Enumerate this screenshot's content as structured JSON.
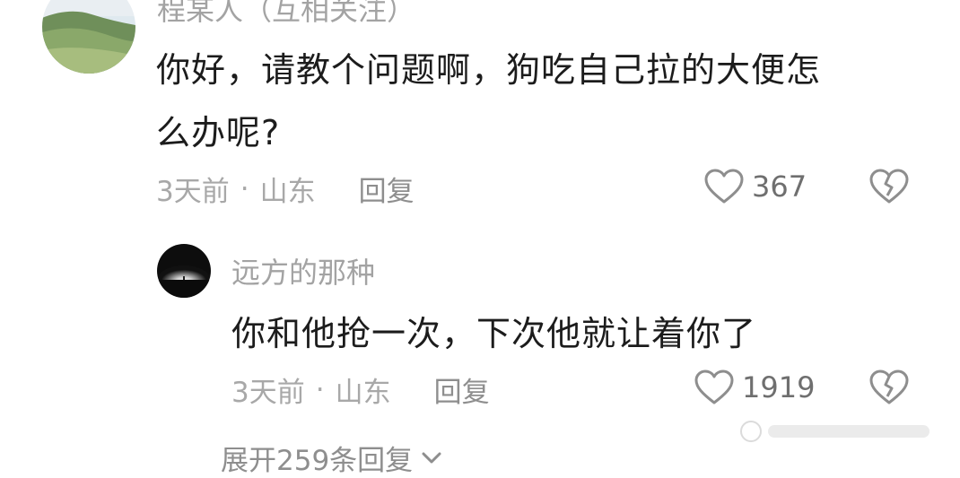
{
  "comment": {
    "username": "程某人（互相关注）",
    "avatar": "landscape-hills-avatar",
    "text_line1": "你好，请教个问题啊，狗吃自己拉的大便怎",
    "text_line2": "么办呢?",
    "time": "3天前",
    "separator": "·",
    "location": "山东",
    "reply_label": "回复",
    "likes": "367"
  },
  "reply": {
    "username": "远方的那种",
    "avatar": "dark-horizon-avatar",
    "text": "你和他抢一次，下次他就让着你了",
    "time": "3天前",
    "separator": "·",
    "location": "山东",
    "reply_label": "回复",
    "likes": "1919"
  },
  "expand_label": "展开259条回复",
  "icons": {
    "like": "heart-outline-icon",
    "dislike": "broken-heart-icon",
    "expand": "chevron-down-icon"
  },
  "colors": {
    "primary_text": "#1c1c1c",
    "secondary_text": "#a3a3a3",
    "icon": "#8e8e8e"
  }
}
